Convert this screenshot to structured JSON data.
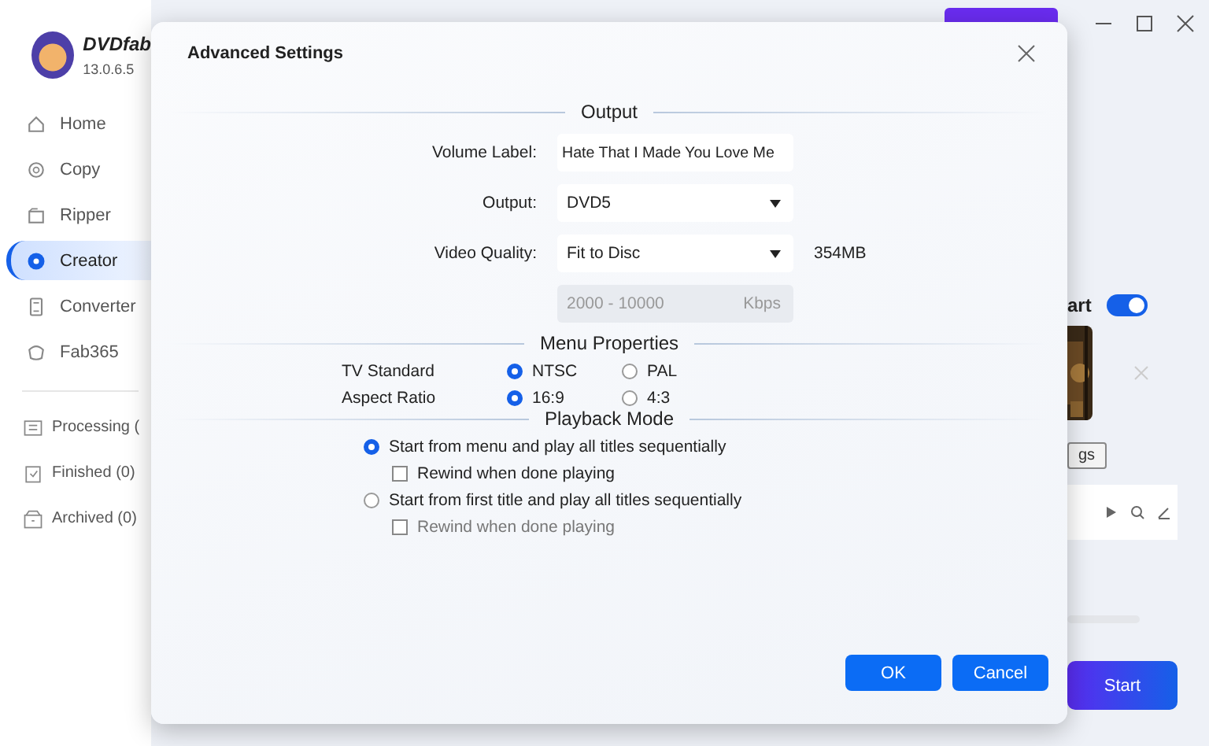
{
  "app": {
    "name": "DVDfab",
    "version": "13.0.6.5"
  },
  "sidebar": {
    "items": [
      {
        "label": "Home",
        "selected": false
      },
      {
        "label": "Copy",
        "selected": false
      },
      {
        "label": "Ripper",
        "selected": false
      },
      {
        "label": "Creator",
        "selected": true
      },
      {
        "label": "Converter",
        "selected": false
      },
      {
        "label": "Fab365",
        "selected": false
      }
    ],
    "queue": [
      {
        "label": "Processing ("
      },
      {
        "label": "Finished (0)"
      },
      {
        "label": "Archived (0)"
      }
    ]
  },
  "main": {
    "option_label": "art",
    "toggle": {
      "on": true
    },
    "settings_button": "gs",
    "progress": {
      "level": 0
    },
    "start_button": "Start"
  },
  "dialog": {
    "title": "Advanced Settings",
    "output": {
      "heading": "Output",
      "volume_label": {
        "label": "Volume Label:",
        "value": "Hate That I Made You Love Me"
      },
      "output": {
        "label": "Output:",
        "value": "DVD5"
      },
      "video_quality": {
        "label": "Video Quality:",
        "value": "Fit to Disc",
        "size": "354MB"
      },
      "bitrate": {
        "placeholder": "2000 - 10000",
        "unit": "Kbps",
        "disabled": true
      }
    },
    "menu_properties": {
      "heading": "Menu Properties",
      "rows": [
        {
          "label": "TV Standard",
          "options": [
            {
              "label": "NTSC",
              "selected": true
            },
            {
              "label": "PAL",
              "selected": false
            }
          ]
        },
        {
          "label": "Aspect Ratio",
          "options": [
            {
              "label": "16:9",
              "selected": true
            },
            {
              "label": "4:3",
              "selected": false
            }
          ]
        }
      ]
    },
    "playback_mode": {
      "heading": "Playback Mode",
      "options": [
        {
          "label": "Start from menu and play all titles sequentially",
          "selected": true,
          "rewind": {
            "label": "Rewind when done playing",
            "checked": false,
            "disabled": false
          }
        },
        {
          "label": "Start from first title and play all titles sequentially",
          "selected": false,
          "rewind": {
            "label": "Rewind when done playing",
            "checked": false,
            "disabled": true
          }
        }
      ]
    },
    "buttons": [
      {
        "label": "OK"
      },
      {
        "label": "Cancel"
      }
    ]
  }
}
